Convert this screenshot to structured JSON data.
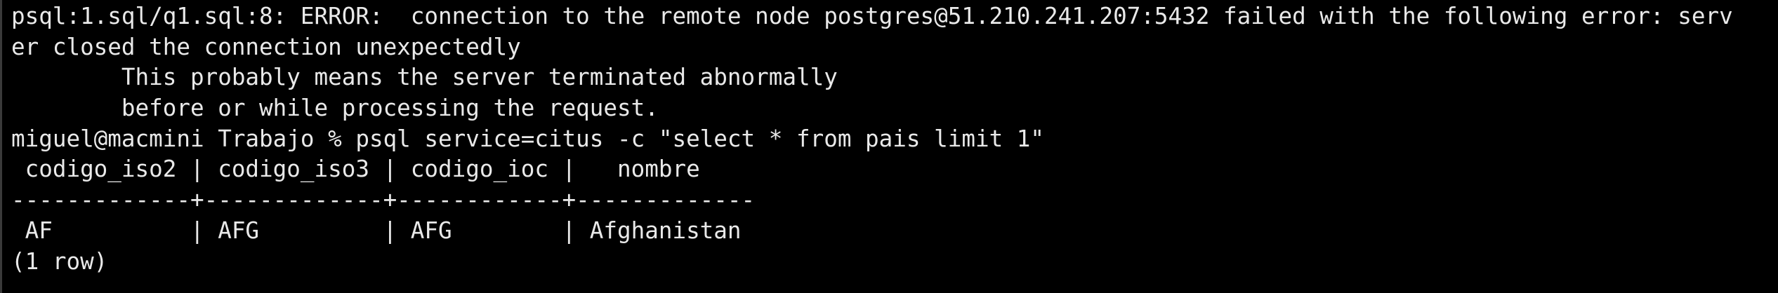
{
  "colors": {
    "background": "#000000",
    "foreground": "#e9e9e9"
  },
  "terminal": {
    "lines": [
      "psql:1.sql/q1.sql:8: ERROR:  connection to the remote node postgres@51.210.241.207:5432 failed with the following error: serv",
      "er closed the connection unexpectedly",
      "        This probably means the server terminated abnormally",
      "        before or while processing the request.",
      "miguel@macmini Trabajo % psql service=citus -c \"select * from pais limit 1\"",
      " codigo_iso2 | codigo_iso3 | codigo_ioc |   nombre",
      "-------------+-------------+------------+-------------",
      " AF          | AFG         | AFG        | Afghanistan",
      "(1 row)"
    ]
  }
}
